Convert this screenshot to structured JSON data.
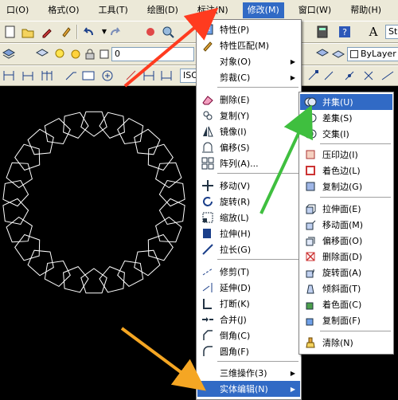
{
  "menubar": {
    "items": [
      "口(O)",
      "格式(O)",
      "工具(T)",
      "绘图(D)",
      "标注(N)",
      "修改(M)",
      "窗口(W)",
      "帮助(H)"
    ]
  },
  "toolbar": {
    "style_combo": "St",
    "layer_combo": "0",
    "linetype_combo": "ByLayer",
    "dim_combo": "ISO"
  },
  "modify_menu": {
    "items": [
      {
        "label": "特性(P)",
        "icon": "properties-icon"
      },
      {
        "label": "特性匹配(M)",
        "icon": "match-properties-icon"
      },
      {
        "label": "对象(O)",
        "icon": "",
        "submenu": true
      },
      {
        "label": "剪裁(C)",
        "icon": "",
        "submenu": true
      },
      {
        "label": "删除(E)",
        "icon": "eraser-icon"
      },
      {
        "label": "复制(Y)",
        "icon": "copy-icon"
      },
      {
        "label": "镜像(I)",
        "icon": "mirror-icon"
      },
      {
        "label": "偏移(S)",
        "icon": "offset-icon"
      },
      {
        "label": "阵列(A)...",
        "icon": "array-icon"
      },
      {
        "label": "移动(V)",
        "icon": "move-icon"
      },
      {
        "label": "旋转(R)",
        "icon": "rotate-icon"
      },
      {
        "label": "缩放(L)",
        "icon": "scale-icon"
      },
      {
        "label": "拉伸(H)",
        "icon": "stretch-icon"
      },
      {
        "label": "拉长(G)",
        "icon": "lengthen-icon"
      },
      {
        "label": "修剪(T)",
        "icon": "trim-icon"
      },
      {
        "label": "延伸(D)",
        "icon": "extend-icon"
      },
      {
        "label": "打断(K)",
        "icon": "break-icon"
      },
      {
        "label": "合并(J)",
        "icon": "join-icon"
      },
      {
        "label": "倒角(C)",
        "icon": "chamfer-icon"
      },
      {
        "label": "圆角(F)",
        "icon": "fillet-icon"
      },
      {
        "label": "三维操作(3)",
        "icon": "",
        "submenu": true
      },
      {
        "label": "实体编辑(N)",
        "icon": "",
        "submenu": true,
        "highlighted": true
      }
    ]
  },
  "solid_menu": {
    "items": [
      {
        "label": "并集(U)",
        "icon": "union-icon",
        "highlighted": true
      },
      {
        "label": "差集(S)",
        "icon": "subtract-icon"
      },
      {
        "label": "交集(I)",
        "icon": "intersect-icon"
      },
      {
        "label": "压印边(I)",
        "icon": "imprint-edges-icon"
      },
      {
        "label": "着色边(L)",
        "icon": "color-edges-icon"
      },
      {
        "label": "复制边(G)",
        "icon": "copy-edges-icon"
      },
      {
        "label": "拉伸面(E)",
        "icon": "extrude-faces-icon"
      },
      {
        "label": "移动面(M)",
        "icon": "move-faces-icon"
      },
      {
        "label": "偏移面(O)",
        "icon": "offset-faces-icon"
      },
      {
        "label": "删除面(D)",
        "icon": "delete-faces-icon"
      },
      {
        "label": "旋转面(A)",
        "icon": "rotate-faces-icon"
      },
      {
        "label": "倾斜面(T)",
        "icon": "taper-faces-icon"
      },
      {
        "label": "着色面(C)",
        "icon": "color-faces-icon"
      },
      {
        "label": "复制面(F)",
        "icon": "copy-faces-icon"
      },
      {
        "label": "清除(N)",
        "icon": "clean-icon"
      }
    ]
  },
  "colors": {
    "highlight": "#316ac5",
    "toolbar_bg": "#ece9d8",
    "canvas_bg": "#000000",
    "arrow_red": "#ff3b1f",
    "arrow_green": "#3fbf3f",
    "arrow_orange": "#f5a623",
    "drawing_stroke": "#ffffff"
  },
  "drawing": {
    "shape": "pentagon-ring",
    "pentagon_count": 26
  }
}
